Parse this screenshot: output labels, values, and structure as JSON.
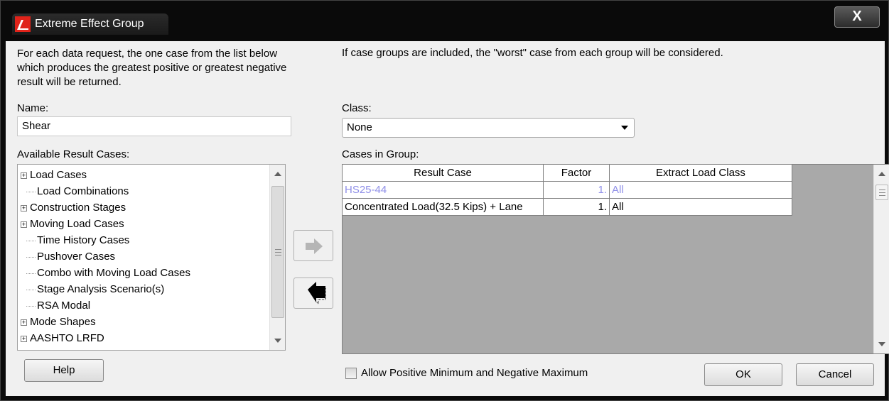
{
  "window": {
    "title": "Extreme Effect Group",
    "close_label": "X"
  },
  "description": {
    "left": "For each data request, the one case from the list below which produces the greatest positive or greatest negative result will be returned.",
    "right": "If case groups are included, the \"worst\" case from each group will be considered."
  },
  "name": {
    "label": "Name:",
    "value": "Shear"
  },
  "class": {
    "label": "Class:",
    "value": "None"
  },
  "available": {
    "label": "Available Result Cases:",
    "items": [
      {
        "label": "Load Cases",
        "expandable": true
      },
      {
        "label": "Load Combinations",
        "expandable": false
      },
      {
        "label": "Construction Stages",
        "expandable": true
      },
      {
        "label": "Moving Load Cases",
        "expandable": true
      },
      {
        "label": "Time History Cases",
        "expandable": false
      },
      {
        "label": "Pushover Cases",
        "expandable": false
      },
      {
        "label": "Combo with Moving Load Cases",
        "expandable": false
      },
      {
        "label": "Stage Analysis Scenario(s)",
        "expandable": false
      },
      {
        "label": "RSA Modal",
        "expandable": false
      },
      {
        "label": "Mode Shapes",
        "expandable": true
      },
      {
        "label": "AASHTO LRFD",
        "expandable": true
      }
    ]
  },
  "group": {
    "label": "Cases in Group:",
    "columns": [
      "Result Case",
      "Factor",
      "Extract Load Class"
    ],
    "rows": [
      {
        "case": "HS25-44",
        "factor": "1.",
        "load_class": "All",
        "highlight": true
      },
      {
        "case": "Concentrated Load(32.5 Kips) + Lane",
        "factor": "1.",
        "load_class": "All",
        "highlight": false
      }
    ]
  },
  "checkbox_label": "Allow Positive Minimum and Negative Maximum",
  "buttons": {
    "help": "Help",
    "ok": "OK",
    "cancel": "Cancel"
  },
  "colors": {
    "accent_row": "#8f8fe8",
    "icon_red": "#e0231a"
  }
}
